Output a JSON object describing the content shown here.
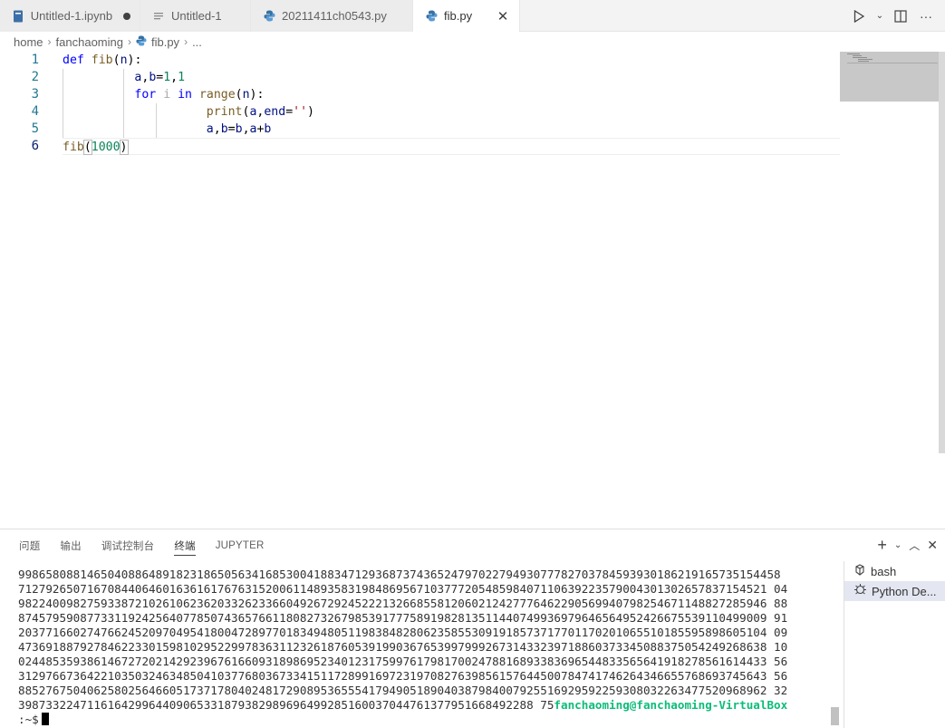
{
  "tabs": [
    {
      "label": "Untitled-1.ipynb",
      "icon": "notebook-icon",
      "dirty": true,
      "active": false
    },
    {
      "label": "Untitled-1",
      "icon": "file-icon",
      "dirty": false,
      "active": false
    },
    {
      "label": "20211411ch0543.py",
      "icon": "python-icon",
      "dirty": false,
      "active": false
    },
    {
      "label": "fib.py",
      "icon": "python-icon",
      "dirty": false,
      "active": true
    }
  ],
  "tab_actions": [
    "run-icon",
    "chevron-down-icon",
    "split-editor-icon",
    "more-icon"
  ],
  "breadcrumb": {
    "root": "home",
    "folder": "fanchaoming",
    "file": "fib.py",
    "tail": "..."
  },
  "editor": {
    "line_numbers": [
      "1",
      "2",
      "3",
      "4",
      "5",
      "6"
    ],
    "current_line": 6
  },
  "panel": {
    "tabs": [
      "问题",
      "输出",
      "调试控制台",
      "终端",
      "JUPYTER"
    ],
    "active_tab": "终端",
    "terminal_lines": [
      "99865808814650408864891823186505634168530041883471293687374365247970227949307778270378459393018621916573515445‌8",
      "7127926507167084406460163616176763152006114893583198486956710377720548598407110639223579004301302657837154521 04",
      "9822400982759338721026106236203326233660492672924522213266855812060212427776462290569940798254671148827285946 88",
      "8745795908773311924256407785074365766118082732679853917775891982813511440749936979646564952426675539110499009 91",
      "2037716602747662452097049541800472897701834948051198384828062358553091918573717701170201065510185595898605104 09",
      "4736918879278462233015981029522997836311232618760539199036765399799926731433239718860373345088375054249268638 10",
      "0244853593861467272021429239676166093189869523401231759976179817002478816893383696544833565641918278561614433 56",
      "3129766736422103503246348504103776803673341511728991697231970827639856157644500784741746264346655768693745643 56",
      "8852767504062580256466051737178040248172908953655541794905189040387984007925516929592259308032263477520968962 32"
    ],
    "last_numbers": "398733224711616429964409065331879382989696499285160037044761377951668492288 75",
    "prompt_user": "fanchaoming@fanchaoming-VirtualBox",
    "prompt_tail": ":~$",
    "terminal_list": [
      {
        "label": "bash",
        "icon": "terminal-icon"
      },
      {
        "label": "Python De...",
        "icon": "debug-icon"
      }
    ]
  }
}
